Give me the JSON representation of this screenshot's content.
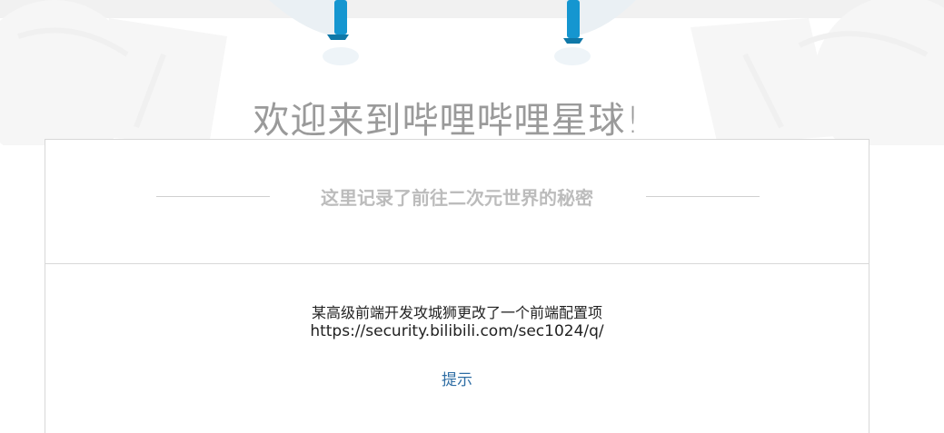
{
  "welcome": {
    "title": "欢迎来到哔哩哔哩星球!"
  },
  "card": {
    "subtitle": "这里记录了前往二次元世界的秘密",
    "puzzle_text": "某高级前端开发攻城狮更改了一个前端配置项",
    "url": "https://security.bilibili.com/sec1024/q/",
    "hint_link": "提示"
  },
  "colors": {
    "accent_blue": "#1596d0",
    "link": "#2e6da4",
    "title_gray": "#9a9a9a",
    "subtitle_gray": "#bcbcbc",
    "border": "#d8d8d8"
  },
  "icons": {
    "top_illustration": "mascot-legs-illustration"
  }
}
